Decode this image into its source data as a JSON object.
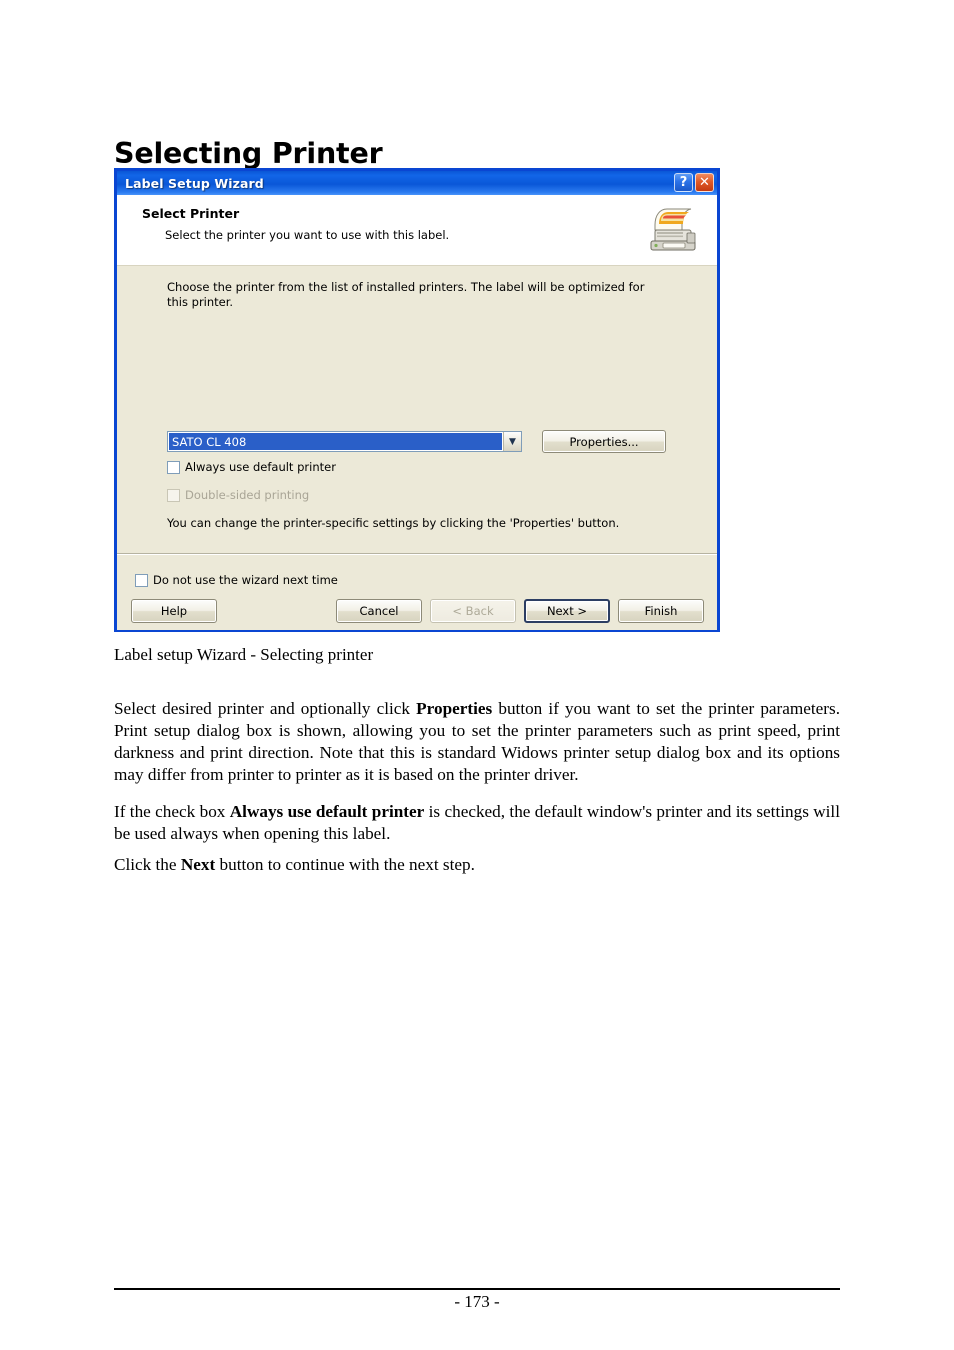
{
  "page": {
    "title": "Selecting Printer",
    "caption": "Label setup Wizard - Selecting printer",
    "page_number": "- 173 -"
  },
  "dialog": {
    "titlebar": {
      "title": "Label Setup Wizard",
      "help_button": "?",
      "close_button": "✕"
    },
    "header": {
      "title": "Select Printer",
      "subtitle": "Select the printer you want to use with this label.",
      "icon": "printer-icon"
    },
    "body": {
      "instructions": "Choose the printer from the list of installed printers. The label will be optimized for this printer.",
      "printer_combo": {
        "value": "SATO CL 408",
        "arrow_icon": "chevron-down-icon"
      },
      "properties_button": "Properties...",
      "checkbox_always_default": {
        "label": "Always use default printer",
        "checked": false,
        "enabled": true
      },
      "checkbox_double_sided": {
        "label": "Double-sided printing",
        "checked": false,
        "enabled": false
      },
      "note": "You can change the printer-specific settings by clicking the 'Properties' button."
    },
    "footer": {
      "checkbox_no_wizard": {
        "label": "Do not use the wizard next time",
        "checked": false
      },
      "buttons": {
        "help": "Help",
        "cancel": "Cancel",
        "back": "< Back",
        "next": "Next >",
        "finish": "Finish"
      }
    }
  },
  "prose": {
    "p1_a": "Select desired printer and optionally click ",
    "p1_b": "Properties",
    "p1_c": " button if you want to set the printer parameters. Print setup dialog box is shown, allowing you to set the printer parameters such as print speed, print darkness and print direction. Note that this is standard Widows printer setup dialog box and its options may differ from printer to printer as it is based on the printer driver.",
    "p2_a": "If the check box ",
    "p2_b": "Always use default printer",
    "p2_c": " is checked, the default window's printer and its settings will be used always when opening this label.",
    "p3_a": "Click the ",
    "p3_b": "Next",
    "p3_c": " button to continue with the next step."
  },
  "colors": {
    "title_bar_blue": "#0a57d8",
    "dialog_border": "#0a46d2",
    "dialog_face": "#ece9d8",
    "selection_blue": "#2a5fc8",
    "close_button_red": "#e05a28"
  }
}
